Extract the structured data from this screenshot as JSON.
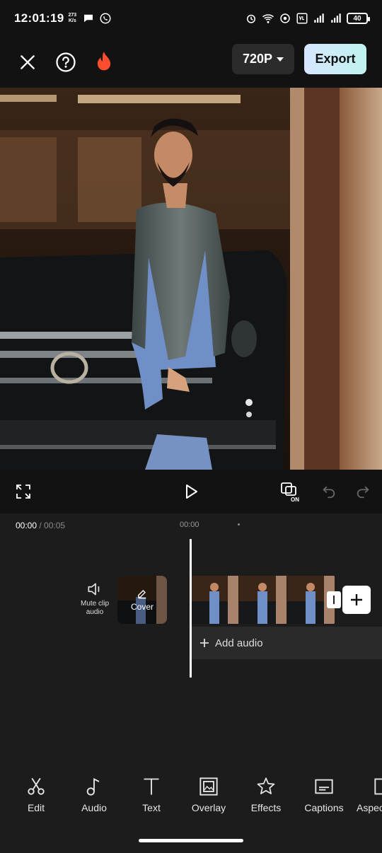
{
  "status_bar": {
    "time": "12:01:19",
    "speed_value": "273",
    "speed_unit": "K/s",
    "battery": "40"
  },
  "top_bar": {
    "resolution": "720P",
    "export_label": "Export"
  },
  "timeline": {
    "current_time": "00:00",
    "separator": " / ",
    "total_time": "00:05",
    "ruler_label": "00:00",
    "mute_label": "Mute clip audio",
    "cover_label": "Cover",
    "add_audio_label": "Add audio"
  },
  "tools": [
    {
      "label": "Edit",
      "icon": "scissors-icon"
    },
    {
      "label": "Audio",
      "icon": "music-note-icon"
    },
    {
      "label": "Text",
      "icon": "text-icon"
    },
    {
      "label": "Overlay",
      "icon": "overlay-icon"
    },
    {
      "label": "Effects",
      "icon": "sparkle-star-icon"
    },
    {
      "label": "Captions",
      "icon": "captions-icon"
    },
    {
      "label": "Aspec",
      "icon": "aspect-ratio-icon"
    }
  ],
  "colors": {
    "background": "#121212",
    "panel": "#1c1c1c",
    "export_gradient_start": "#d7e6ff",
    "export_gradient_end": "#bff3ef",
    "flame": "#ff4d2e"
  }
}
